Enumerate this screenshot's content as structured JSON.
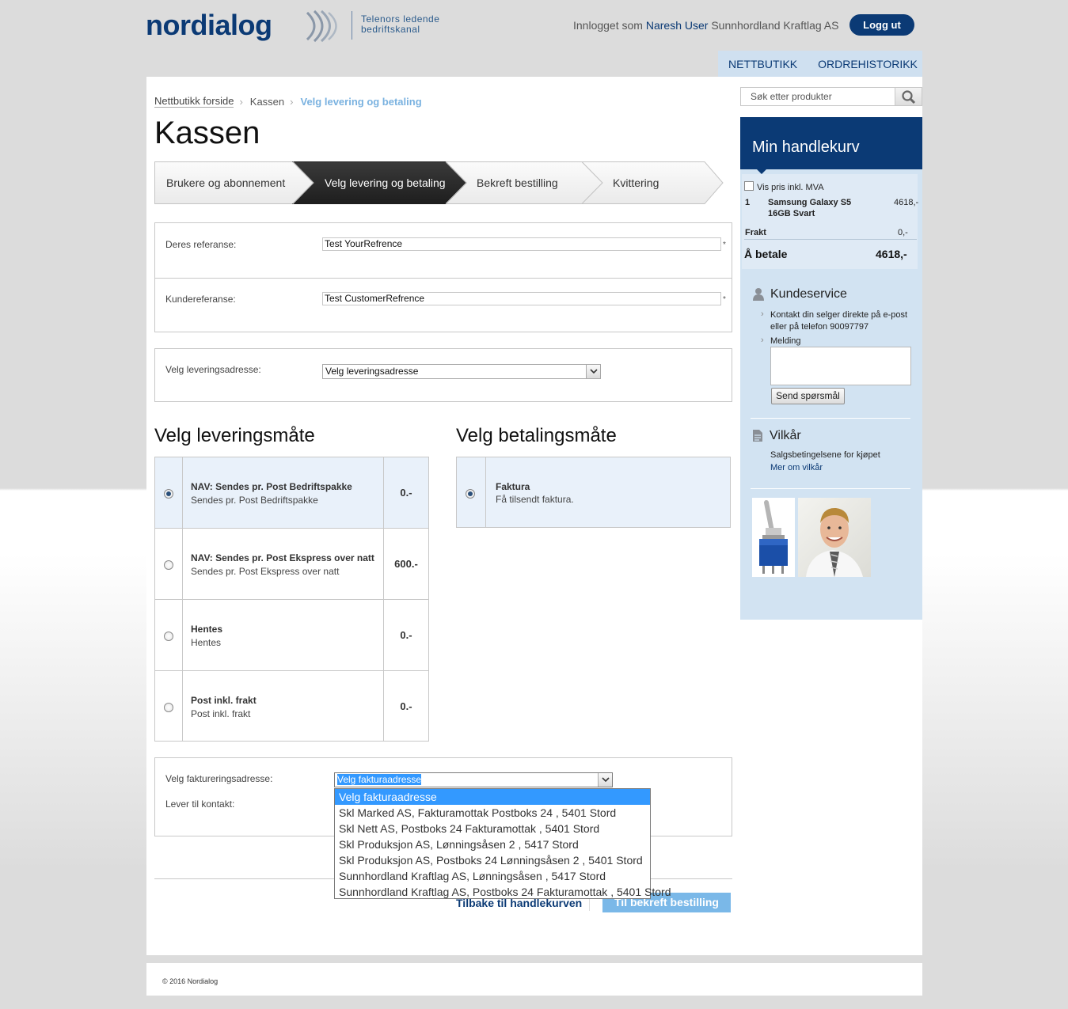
{
  "header": {
    "logo": "nordialog",
    "tagline_line1": "Telenors ledende",
    "tagline_line2": "bedriftskanal",
    "login_prefix": "Innlogget som",
    "user_name": "Naresh User",
    "company": "Sunnhordland Kraftlag AS",
    "logout_label": "Logg ut"
  },
  "nav": {
    "items": [
      {
        "label": "NETTBUTIKK"
      },
      {
        "label": "ORDREHISTORIKK"
      }
    ]
  },
  "breadcrumb": {
    "items": [
      {
        "label": "Nettbutikk forside"
      },
      {
        "label": "Kassen"
      },
      {
        "label": "Velg levering og betaling"
      }
    ]
  },
  "page_title": "Kassen",
  "steps": [
    {
      "label": "Brukere og abonnement"
    },
    {
      "label": "Velg levering og betaling"
    },
    {
      "label": "Bekreft bestilling"
    },
    {
      "label": "Kvittering"
    }
  ],
  "form": {
    "reference_label": "Deres referanse:",
    "reference_value": "Test YourRefrence",
    "customer_ref_label": "Kundereferanse:",
    "customer_ref_value": "Test CustomerRefrence",
    "required_mark": "*",
    "delivery_address_label": "Velg leveringsadresse:",
    "delivery_address_value": "Velg leveringsadresse"
  },
  "shipping": {
    "title": "Velg leveringsmåte",
    "options": [
      {
        "title": "NAV: Sendes pr. Post Bedriftspakke",
        "sub": "Sendes pr. Post Bedriftspakke",
        "price": "0.-",
        "selected": true
      },
      {
        "title": "NAV: Sendes pr. Post Ekspress over natt",
        "sub": "Sendes pr. Post Ekspress over natt",
        "price": "600.-",
        "selected": false
      },
      {
        "title": "Hentes",
        "sub": "Hentes",
        "price": "0.-",
        "selected": false
      },
      {
        "title": "Post inkl. frakt",
        "sub": "Post inkl. frakt",
        "price": "0.-",
        "selected": false
      }
    ]
  },
  "payment": {
    "title": "Velg betalingsmåte",
    "options": [
      {
        "title": "Faktura",
        "sub": "Få tilsendt faktura.",
        "selected": true
      }
    ]
  },
  "billing": {
    "address_label": "Velg faktureringsadresse:",
    "address_value": "Velg fakturaadresse",
    "contact_label": "Lever til kontakt:",
    "dropdown_options": [
      "Velg fakturaadresse",
      "Skl Marked AS, Fakturamottak Postboks 24 , 5401 Stord",
      "Skl Nett AS, Postboks 24 Fakturamottak , 5401 Stord",
      "Skl Produksjon AS, Lønningsåsen 2 , 5417 Stord",
      "Skl Produksjon AS, Postboks 24 Lønningsåsen 2 , 5401 Stord",
      "Sunnhordland Kraftlag AS, Lønningsåsen , 5417 Stord",
      "Sunnhordland Kraftlag AS, Postboks 24 Fakturamottak , 5401 Stord"
    ]
  },
  "actions": {
    "back_label": "Tilbake til handlekurven",
    "confirm_label": "Til bekreft bestilling"
  },
  "sidebar": {
    "search_placeholder": "Søk etter produkter",
    "cart_title": "Min handlekurv",
    "vat_label": "Vis pris inkl. MVA",
    "cart_item_qty": "1",
    "cart_item_name1": "Samsung Galaxy S5",
    "cart_item_name2": "16GB Svart",
    "cart_item_price": "4618,-",
    "shipping_label": "Frakt",
    "shipping_price": "0,-",
    "total_label": "Å betale",
    "total_price": "4618,-",
    "service_title": "Kundeservice",
    "service_text1": "Kontakt din selger direkte på e-post",
    "service_text2": "eller på telefon 90097797",
    "message_label": "Melding",
    "send_label": "Send spørsmål",
    "terms_title": "Vilkår",
    "terms_text": "Salgsbetingelsene for kjøpet",
    "terms_link": "Mer om vilkår"
  },
  "footer": {
    "copyright": "© 2016 Nordialog"
  },
  "colors": {
    "brand": "#0b3a75",
    "accent": "#7ab8e8",
    "sidebar_bg": "#d2e3f2"
  }
}
